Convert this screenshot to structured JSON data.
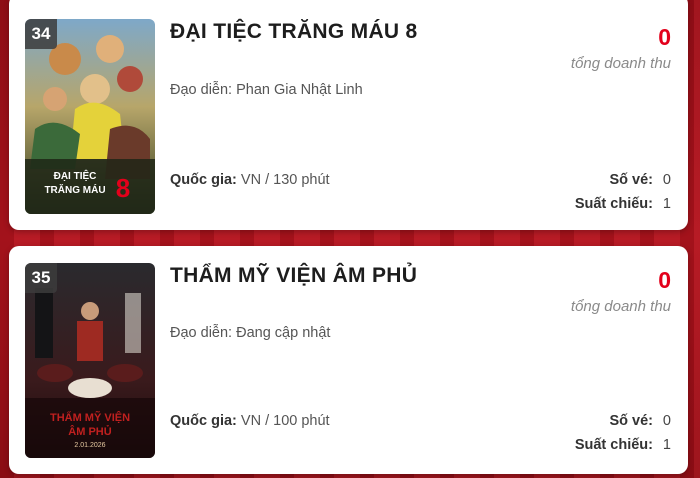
{
  "movies": [
    {
      "rank": "34",
      "title": "ĐẠI TIỆC TRĂNG MÁU 8",
      "director": "Đạo diễn: Phan Gia Nhật Linh",
      "country_label": "Quốc gia:",
      "country_value": " VN / 130 phút",
      "revenue": "0",
      "revenue_label": "tổng doanh thu",
      "tickets_label": "Số vé:",
      "tickets_value": "0",
      "shows_label": "Suất chiếu:",
      "shows_value": "1",
      "poster_text": [
        "ĐẠI TIỆC",
        "TRĂNG MÁU"
      ],
      "poster_number": "8"
    },
    {
      "rank": "35",
      "title": "THẨM MỸ VIỆN ÂM PHỦ",
      "director": "Đạo diễn: Đang cập nhật",
      "country_label": "Quốc gia:",
      "country_value": " VN / 100 phút",
      "revenue": "0",
      "revenue_label": "tổng doanh thu",
      "tickets_label": "Số vé:",
      "tickets_value": "0",
      "shows_label": "Suất chiếu:",
      "shows_value": "1",
      "poster_text": [
        "THẨM MỸ VIỆN",
        "ÂM PHỦ"
      ],
      "poster_date": "2.01.2026"
    }
  ],
  "colors": {
    "background": "#a3111a",
    "revenue": "#e3001b",
    "title": "#1d1d1d"
  }
}
